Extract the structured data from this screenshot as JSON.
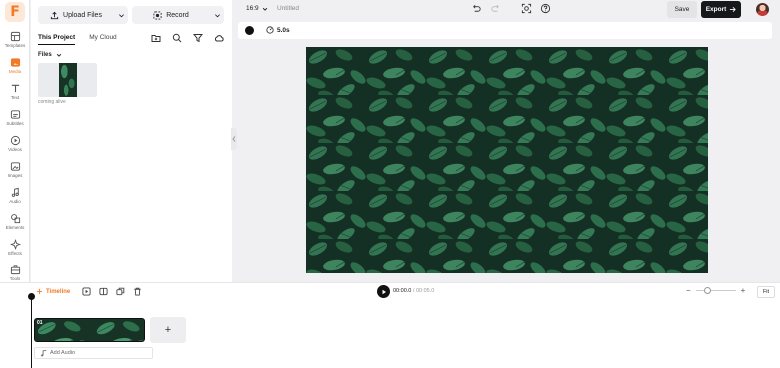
{
  "app": {
    "logo_letter": "F",
    "brand_color": "#f07a28"
  },
  "rail": {
    "items": [
      {
        "label": "Templates",
        "icon": "templates-icon"
      },
      {
        "label": "Media",
        "icon": "media-icon",
        "active": true
      },
      {
        "label": "Text",
        "icon": "text-icon"
      },
      {
        "label": "Subtitles",
        "icon": "subtitles-icon"
      },
      {
        "label": "Videos",
        "icon": "videos-icon"
      },
      {
        "label": "Images",
        "icon": "images-icon"
      },
      {
        "label": "Audio",
        "icon": "audio-icon"
      },
      {
        "label": "Elements",
        "icon": "elements-icon"
      },
      {
        "label": "Effects",
        "icon": "effects-icon"
      },
      {
        "label": "Tools",
        "icon": "tools-icon"
      }
    ]
  },
  "panel": {
    "upload_label": "Upload Files",
    "record_label": "Record",
    "tabs": [
      {
        "label": "This Project",
        "active": true
      },
      {
        "label": "My Cloud"
      }
    ],
    "files_label": "Files",
    "file": {
      "name": "coming alive"
    }
  },
  "topbar": {
    "aspect_ratio": "16:9",
    "project_title": "Untitled",
    "save_label": "Save",
    "export_label": "Export"
  },
  "subbar": {
    "background_color": "#111111",
    "duration": "5.0s"
  },
  "timeline": {
    "label": "Timeline",
    "current_time": "00:00.0",
    "separator": "/",
    "total_time": "00:05.0",
    "zoom_minus": "−",
    "zoom_plus": "+",
    "zoom_level": 0.2,
    "fit_label": "Fit",
    "clip_number": "01",
    "add_clip_label": "+",
    "add_audio_label": "Add Audio"
  }
}
